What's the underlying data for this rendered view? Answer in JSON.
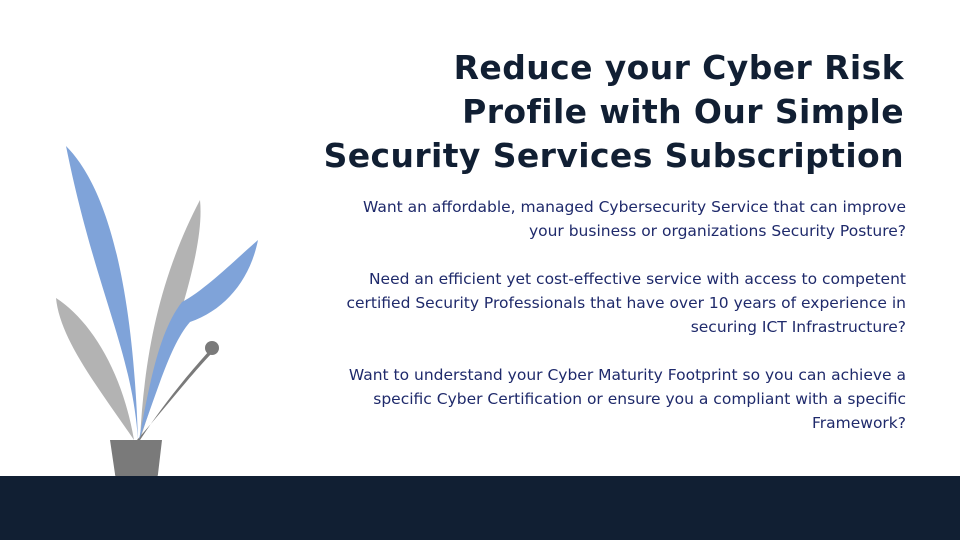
{
  "headline": {
    "lines": [
      "Reduce your Cyber Risk",
      "Profile with Our Simple",
      "Security Services Subscription"
    ]
  },
  "paragraphs": [
    {
      "lines": [
        "Want an affordable, managed Cybersecurity Service that can improve",
        "your business or organizations Security Posture?"
      ]
    },
    {
      "lines": [
        "Need an efficient yet cost-effective service with access to competent",
        "certified Security Professionals that have over 10 years of experience in",
        "securing ICT Infrastructure?"
      ]
    },
    {
      "lines": [
        "Want to understand your Cyber Maturity Footprint so you can achieve a",
        "specific Cyber Certification or ensure you a compliant with a specific",
        "Framework?"
      ]
    }
  ],
  "colors": {
    "headline": "#111f33",
    "body": "#1f2a6b",
    "footer": "#111f33",
    "leaf_blue": "#7fa3d9",
    "leaf_gray": "#b3b3b3",
    "pot": "#7a7a7a"
  }
}
